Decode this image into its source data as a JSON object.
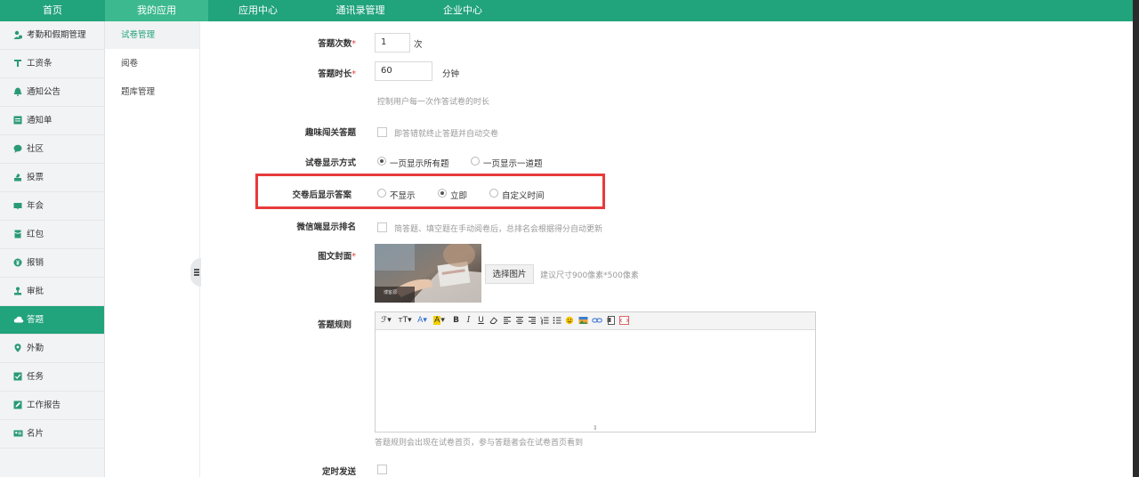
{
  "topnav": {
    "items": [
      {
        "label": "首页",
        "active": false
      },
      {
        "label": "我的应用",
        "active": true
      },
      {
        "label": "应用中心",
        "active": false
      },
      {
        "label": "通讯录管理",
        "active": false
      },
      {
        "label": "企业中心",
        "active": false
      }
    ]
  },
  "sidebar": {
    "items": [
      {
        "label": "考勤和假期管理",
        "icon": "user-clock-icon"
      },
      {
        "label": "工资条",
        "icon": "salary-icon"
      },
      {
        "label": "通知公告",
        "icon": "bell-icon"
      },
      {
        "label": "通知单",
        "icon": "notice-icon"
      },
      {
        "label": "社区",
        "icon": "chat-icon"
      },
      {
        "label": "投票",
        "icon": "vote-icon"
      },
      {
        "label": "年会",
        "icon": "banner-icon"
      },
      {
        "label": "红包",
        "icon": "red-packet-icon"
      },
      {
        "label": "报销",
        "icon": "coin-icon"
      },
      {
        "label": "审批",
        "icon": "approve-icon"
      },
      {
        "label": "答题",
        "icon": "cloud-icon",
        "active": true
      },
      {
        "label": "外勤",
        "icon": "location-pin-icon"
      },
      {
        "label": "任务",
        "icon": "task-check-icon"
      },
      {
        "label": "工作报告",
        "icon": "report-edit-icon"
      },
      {
        "label": "名片",
        "icon": "business-card-icon"
      }
    ]
  },
  "submenu": {
    "items": [
      {
        "label": "试卷管理",
        "active": true
      },
      {
        "label": "阅卷"
      },
      {
        "label": "题库管理"
      }
    ]
  },
  "form": {
    "attempts": {
      "label": "答题次数",
      "value": "1",
      "unit": "次"
    },
    "duration": {
      "label": "答题时长",
      "value": "60",
      "unit": "分钟",
      "hint": "控制用户每一次作答试卷的时长"
    },
    "fun_pass": {
      "label": "趣味闯关答题",
      "text": "即答错就终止答题并自动交卷"
    },
    "display_mode": {
      "label": "试卷显示方式",
      "options": [
        "一页显示所有题",
        "一页显示一道题"
      ],
      "selected": 0
    },
    "show_answer": {
      "label": "交卷后显示答案",
      "options": [
        "不显示",
        "立即",
        "自定义时间"
      ],
      "selected": 1
    },
    "wechat_rank": {
      "label": "微信端显示排名",
      "text": "简答题、填空题在手动阅卷后，总排名会根据得分自动更新"
    },
    "cover": {
      "label": "图文封面",
      "button": "选择图片",
      "hint": "建议尺寸900像素*500像素",
      "caption": "博客源"
    },
    "rules": {
      "label": "答题规则",
      "hint": "答题规则会出现在试卷首页，参与答题者会在试卷首页看到",
      "toolbar": [
        "font-family",
        "font-size",
        "font-color",
        "highlight",
        "bold",
        "italic",
        "underline",
        "eraser",
        "align-left",
        "align-center",
        "align-right",
        "ordered-list",
        "unordered-list",
        "emoji",
        "image",
        "link",
        "table",
        "html"
      ]
    },
    "scheduled_send": {
      "label": "定时发送"
    }
  },
  "colors": {
    "brand": "#21a37c",
    "highlight_box": "#e83a3a"
  }
}
